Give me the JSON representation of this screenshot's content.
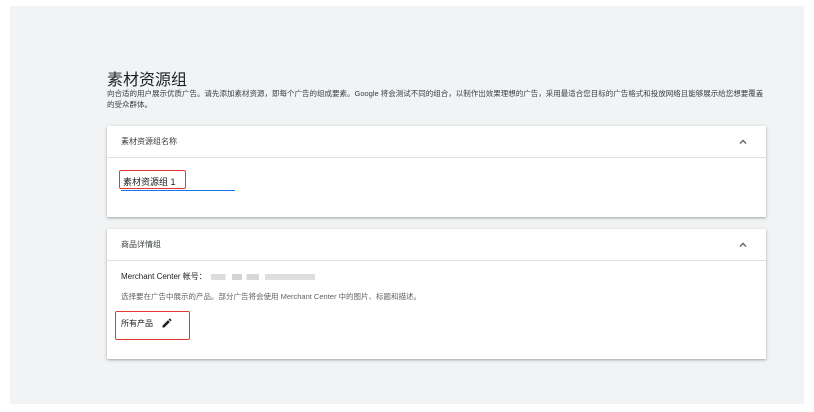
{
  "page": {
    "title": "素材资源组",
    "description": "向合适的用户展示优质广告。请先添加素材资源，即每个广告的组成要素。Google 将会测试不同的组合，以制作出效果理想的广告，采用最适合您目标的广告格式和投放网络且能够展示给您想要覆盖的受众群体。"
  },
  "asset_group_name_card": {
    "title": "素材资源组名称",
    "name_value": "素材资源组 1",
    "expand_icon": "chevron-up-icon"
  },
  "product_details_card": {
    "title": "商品详情组",
    "merchant_label": "Merchant Center 帐号：",
    "description": "选择要在广告中展示的产品。部分广告将会使用 Merchant Center 中的图片、标题和描述。",
    "products_label": "所有产品",
    "edit_icon": "pencil-icon",
    "expand_icon": "chevron-up-icon"
  },
  "colors": {
    "accent": "#1a73e8",
    "highlight": "#e53935"
  }
}
